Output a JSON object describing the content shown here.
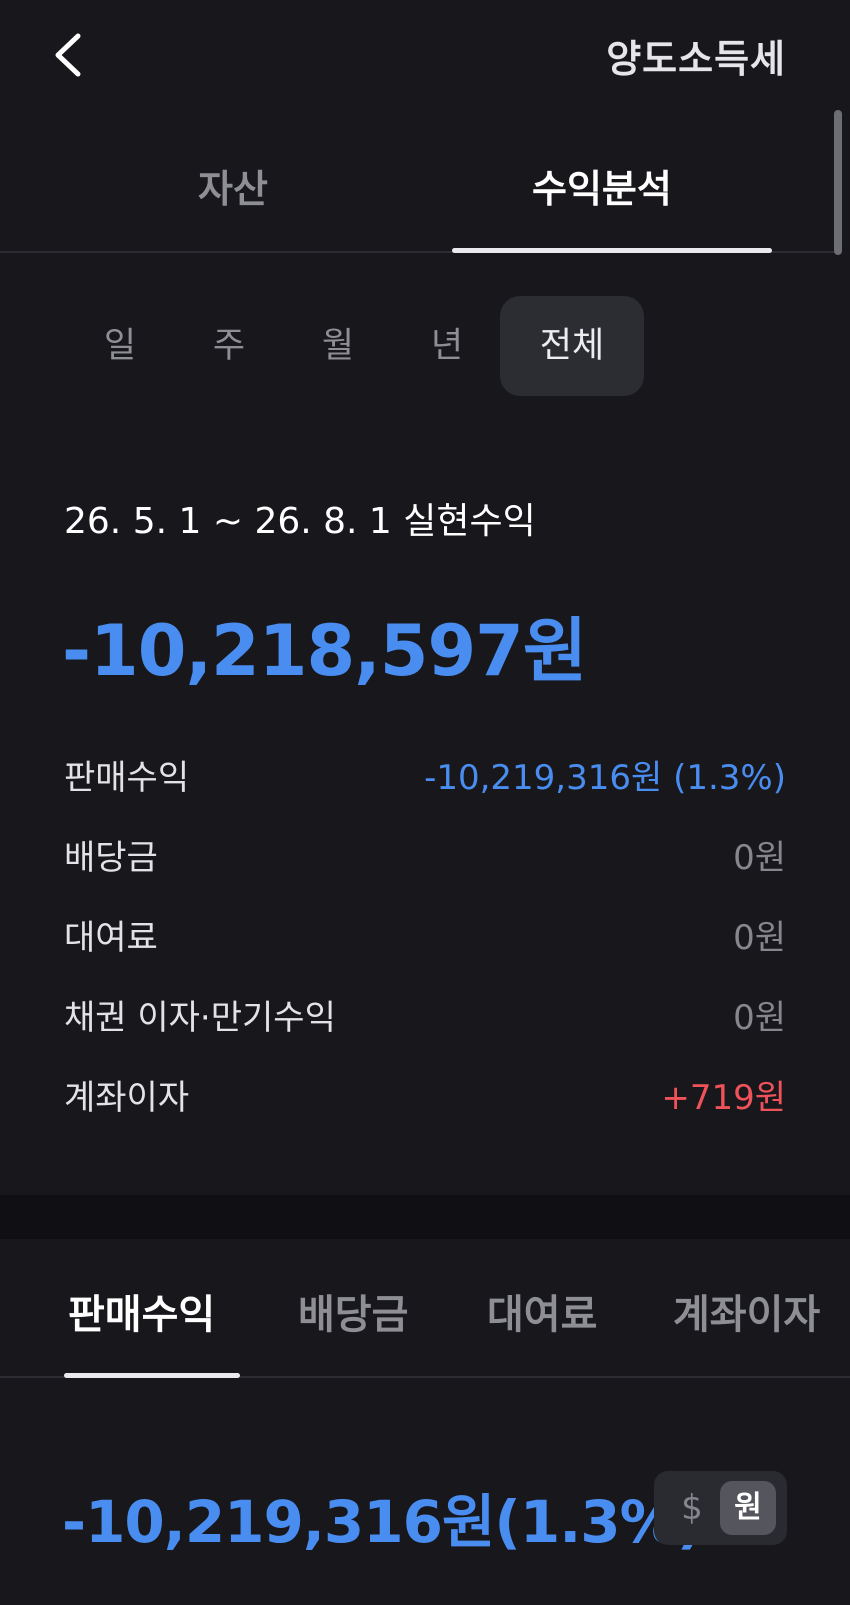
{
  "header": {
    "title": "양도소득세",
    "back_icon": "chevron-left-icon"
  },
  "main_tabs": [
    {
      "label": "자산",
      "active": false
    },
    {
      "label": "수익분석",
      "active": true
    }
  ],
  "periods": [
    {
      "label": "일",
      "active": false
    },
    {
      "label": "주",
      "active": false
    },
    {
      "label": "월",
      "active": false
    },
    {
      "label": "년",
      "active": false
    },
    {
      "label": "전체",
      "active": true
    }
  ],
  "summary": {
    "range_label": "26. 5. 1 ~ 26. 8. 1 실현수익",
    "total": "-10,218,597원",
    "rows": [
      {
        "label": "판매수익",
        "value": "-10,219,316원 (1.3%)",
        "color": "#4a8df0"
      },
      {
        "label": "배당금",
        "value": "0원",
        "color": "#86868d"
      },
      {
        "label": "대여료",
        "value": "0원",
        "color": "#86868d"
      },
      {
        "label": "채권 이자·만기수익",
        "value": "0원",
        "color": "#86868d"
      },
      {
        "label": "계좌이자",
        "value": "+719원",
        "color": "#f0525a"
      }
    ]
  },
  "sub_tabs": [
    {
      "label": "판매수익",
      "active": true
    },
    {
      "label": "배당금",
      "active": false
    },
    {
      "label": "대여료",
      "active": false
    },
    {
      "label": "계좌이자",
      "active": false
    }
  ],
  "sales": {
    "value": "-10,219,316원(1.3%)",
    "currency_dollar": "$",
    "currency_won": "원",
    "currency_selected": "원"
  },
  "colors": {
    "negative": "#4a8df0",
    "positive": "#f0525a",
    "background": "#17171c"
  }
}
